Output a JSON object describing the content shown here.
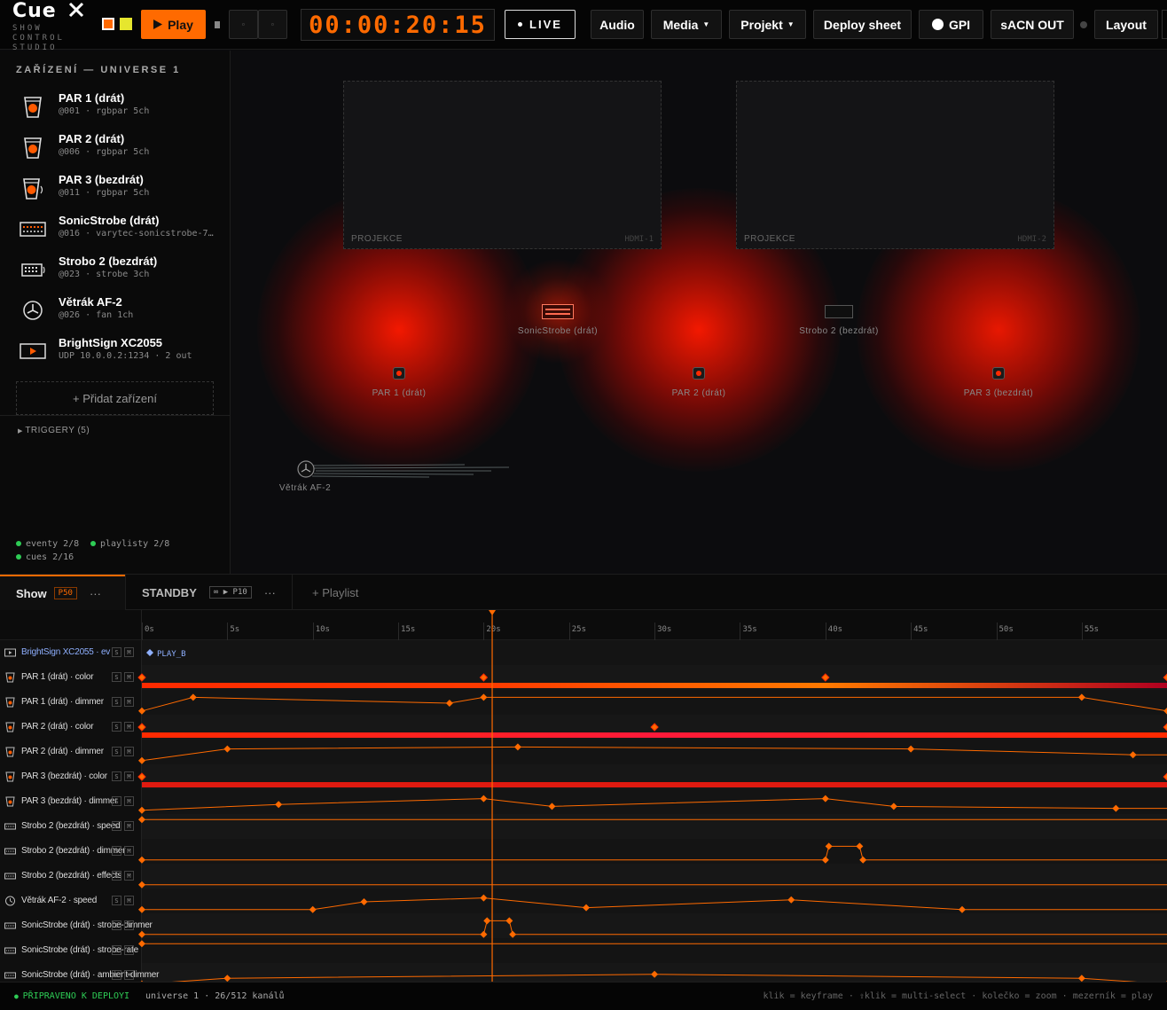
{
  "app": {
    "logo": "Cue",
    "logo_sub": "SHOW CONTROL STUDIO",
    "swatch_colors": [
      "#ff6a00",
      "#e6e62e"
    ]
  },
  "toolbar": {
    "play_label": "Play",
    "play_icon": "play-icon",
    "transport_icons": [
      "stop-icon",
      "rewind-icon",
      "forward-icon"
    ],
    "timecode": "00:00:20:15",
    "live_label": "LIVE",
    "audio_label": "Audio",
    "media_label": "Media",
    "projekt_label": "Projekt",
    "deploy_label": "Deploy sheet",
    "gpi_label": "GPI",
    "sacn_label": "sACN OUT",
    "layout_label": "Layout"
  },
  "sidebar": {
    "heading": "ZAŘÍZENÍ — UNIVERSE 1",
    "devices": [
      {
        "name": "PAR 1 (drát)",
        "sub": "@001 · rgbpar 5ch",
        "icon": "par-icon"
      },
      {
        "name": "PAR 2 (drát)",
        "sub": "@006 · rgbpar 5ch",
        "icon": "par-icon"
      },
      {
        "name": "PAR 3 (bezdrát)",
        "sub": "@011 · rgbpar 5ch",
        "icon": "par-wireless-icon"
      },
      {
        "name": "SonicStrobe (drát)",
        "sub": "@016 · varytec-sonicstrobe-7…",
        "icon": "strobe-icon"
      },
      {
        "name": "Strobo 2 (bezdrát)",
        "sub": "@023 · strobe 3ch",
        "icon": "strobe-wireless-icon"
      },
      {
        "name": "Větrák AF-2",
        "sub": "@026 · fan 1ch",
        "icon": "fan-icon"
      },
      {
        "name": "BrightSign XC2055",
        "sub": "UDP 10.0.0.2:1234 · 2 out",
        "icon": "media-player-icon"
      }
    ],
    "add_device": "+ Přidat zařízení",
    "triggers": "TRIGGERY (5)",
    "stats": {
      "events": "eventy 2/8",
      "playlists": "playlisty 2/8",
      "cues": "cues 2/16"
    }
  },
  "stage": {
    "projections": [
      {
        "label": "PROJEKCE",
        "output": "HDMI-1"
      },
      {
        "label": "PROJEKCE",
        "output": "HDMI-2"
      }
    ],
    "fixtures": {
      "par1": "PAR 1 (drát)",
      "par2": "PAR 2 (drát)",
      "par3": "PAR 3 (bezdrát)",
      "sonic": "SonicStrobe (drát)",
      "strobe2": "Strobo 2 (bezdrát)",
      "fan": "Větrák AF-2"
    }
  },
  "playlists": {
    "show": {
      "label": "Show",
      "tag": "P50"
    },
    "standby": {
      "label": "STANDBY",
      "tag": "∞ ▶ P10"
    },
    "add": "+ Playlist",
    "more": "···"
  },
  "timeline": {
    "ruler_start_seconds": 0,
    "ruler_end_seconds": 60,
    "playhead_seconds": 20.5,
    "ticks": [
      "0s",
      "5s",
      "10s",
      "15s",
      "20s",
      "25s",
      "30s",
      "35s",
      "40s",
      "45s",
      "50s",
      "55s"
    ],
    "tracks": [
      {
        "label": "BrightSign XC2055 · ev",
        "icon": "media-player-icon",
        "type": "event",
        "events": [
          {
            "time": 0,
            "label": "PLAY_B"
          }
        ]
      },
      {
        "label": "PAR 1 (drát) · color",
        "icon": "par-icon",
        "type": "color",
        "keys": [
          0,
          20,
          40,
          60
        ],
        "colors": [
          "#ff2a00",
          "#ff3a00",
          "#ff7a00",
          "#b00020"
        ]
      },
      {
        "label": "PAR 1 (drát) · dimmer",
        "icon": "par-icon",
        "type": "curve",
        "keys": [
          [
            0,
            0.1
          ],
          [
            3,
            0.8
          ],
          [
            18,
            0.5
          ],
          [
            20,
            0.8
          ],
          [
            55,
            0.8
          ],
          [
            60,
            0.1
          ]
        ]
      },
      {
        "label": "PAR 2 (drát) · color",
        "icon": "par-icon",
        "type": "color",
        "keys": [
          0,
          30,
          60
        ],
        "colors": [
          "#ff2a00",
          "#ff1a3a",
          "#ff2a00"
        ]
      },
      {
        "label": "PAR 2 (drát) · dimmer",
        "icon": "par-icon",
        "type": "curve",
        "keys": [
          [
            0,
            0.1
          ],
          [
            5,
            0.7
          ],
          [
            22,
            0.8
          ],
          [
            45,
            0.7
          ],
          [
            58,
            0.4
          ]
        ]
      },
      {
        "label": "PAR 3 (bezdrát) · color",
        "icon": "par-icon",
        "type": "color",
        "keys": [
          0,
          60
        ],
        "colors": [
          "#e01a10",
          "#e01a10"
        ]
      },
      {
        "label": "PAR 3 (bezdrát) · dimmer",
        "icon": "par-icon",
        "type": "curve",
        "keys": [
          [
            0,
            0.1
          ],
          [
            8,
            0.4
          ],
          [
            20,
            0.7
          ],
          [
            24,
            0.3
          ],
          [
            40,
            0.7
          ],
          [
            44,
            0.3
          ],
          [
            57,
            0.2
          ]
        ]
      },
      {
        "label": "Strobo 2 (bezdrát) · speed",
        "icon": "strobe-icon",
        "type": "curve",
        "keys": [
          [
            0,
            0.9
          ]
        ]
      },
      {
        "label": "Strobo 2 (bezdrát) · dimmer",
        "icon": "strobe-icon",
        "type": "curve",
        "keys": [
          [
            0,
            0.1
          ],
          [
            40,
            0.1
          ],
          [
            40.2,
            0.8
          ],
          [
            42,
            0.8
          ],
          [
            42.2,
            0.1
          ]
        ]
      },
      {
        "label": "Strobo 2 (bezdrát) · effects",
        "icon": "strobe-icon",
        "type": "curve",
        "keys": [
          [
            0,
            0.1
          ]
        ]
      },
      {
        "label": "Větrák AF-2 · speed",
        "icon": "fan-icon",
        "type": "curve",
        "keys": [
          [
            0,
            0.1
          ],
          [
            10,
            0.1
          ],
          [
            13,
            0.5
          ],
          [
            20,
            0.7
          ],
          [
            26,
            0.2
          ],
          [
            38,
            0.6
          ],
          [
            48,
            0.1
          ]
        ]
      },
      {
        "label": "SonicStrobe (drát) · strobe-dimmer",
        "icon": "strobe-icon",
        "type": "curve",
        "keys": [
          [
            0,
            0.1
          ],
          [
            20,
            0.1
          ],
          [
            20.2,
            0.8
          ],
          [
            21.5,
            0.8
          ],
          [
            21.7,
            0.1
          ]
        ]
      },
      {
        "label": "SonicStrobe (drát) · strobe-rate",
        "icon": "strobe-icon",
        "type": "curve",
        "keys": [
          [
            0,
            0.9
          ]
        ]
      },
      {
        "label": "SonicStrobe (drát) · ambient-dimmer",
        "icon": "strobe-icon",
        "type": "curve",
        "keys": [
          [
            0,
            0.1
          ],
          [
            5,
            0.4
          ],
          [
            30,
            0.6
          ],
          [
            55,
            0.4
          ],
          [
            60,
            0.1
          ]
        ]
      }
    ]
  },
  "footer": {
    "ready": "PŘIPRAVENO K DEPLOYI",
    "universe": "universe 1 · 26/512 kanálů",
    "hints": "klik = keyframe · ⇧klik = multi-select · kolečko = zoom · mezerník = play"
  },
  "colors": {
    "accent": "#ff6a00",
    "live": "#ffffff",
    "ready": "#2ecc55",
    "glow": "#ff1400"
  }
}
